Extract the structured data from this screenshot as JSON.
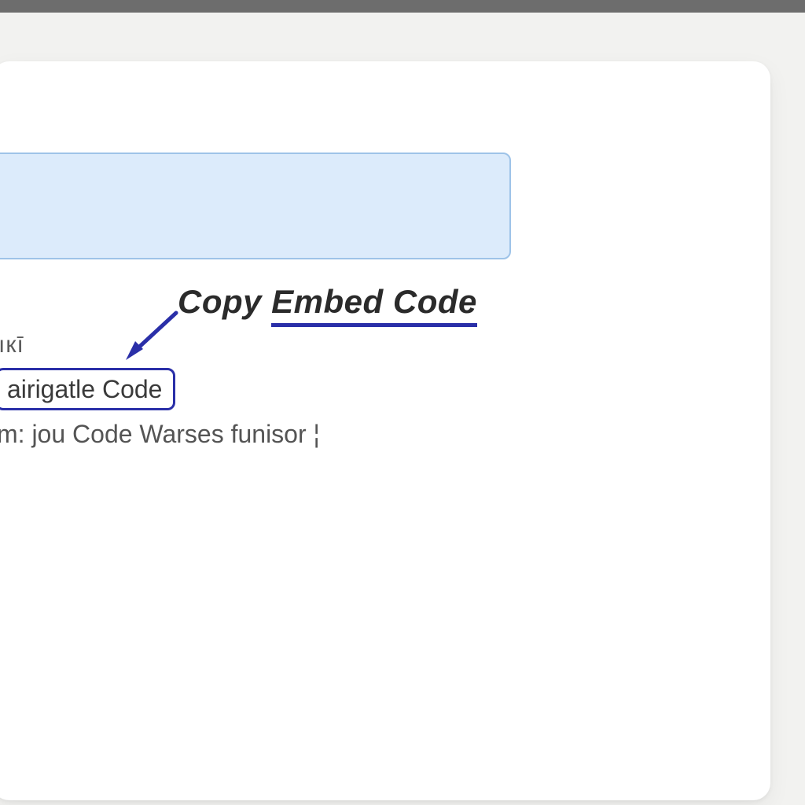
{
  "callout": {
    "prefix": "Copy ",
    "emphasis": "Embed Code"
  },
  "small_label": "ıкī",
  "button_label": "airigatle Code",
  "description_line": "m: jou Code Warses funisor ¦",
  "colors": {
    "accent": "#2a2fa8",
    "preview_bg": "#dcebfb",
    "preview_border": "#9ec3e8",
    "page_bg": "#f2f2f0"
  }
}
